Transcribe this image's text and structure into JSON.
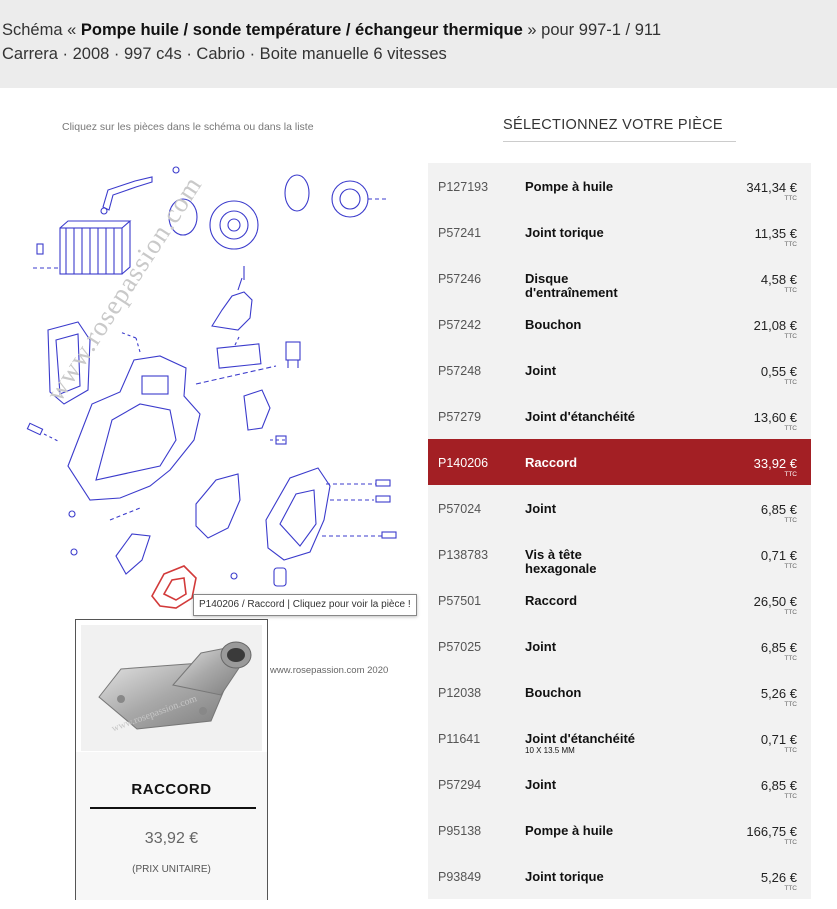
{
  "header": {
    "line1_prefix": "Schéma « ",
    "line1_bold": "Pompe huile / sonde température / échangeur thermique",
    "line1_suffix": " » pour 997-1 / 911",
    "line2": "Carrera · 2008 · 997 c4s · Cabrio · Boite manuelle 6 vitesses"
  },
  "diagram": {
    "hint": "Cliquez sur les pièces dans le schéma ou dans la liste",
    "watermark": "www.rosepassion.com",
    "copyright": "www.rosepassion.com 2020"
  },
  "parts_panel": {
    "title": "SÉLECTIONNEZ VOTRE PIÈCE",
    "ttc_label": "TTC",
    "items": [
      {
        "ref": "P127193",
        "name": "Pompe à huile",
        "sub": "",
        "price": "341,34 €"
      },
      {
        "ref": "P57241",
        "name": "Joint torique",
        "sub": "",
        "price": "11,35 €"
      },
      {
        "ref": "P57246",
        "name": "Disque d'entraînement",
        "sub": "",
        "price": "4,58 €"
      },
      {
        "ref": "P57242",
        "name": "Bouchon",
        "sub": "",
        "price": "21,08 €"
      },
      {
        "ref": "P57248",
        "name": "Joint",
        "sub": "",
        "price": "0,55 €"
      },
      {
        "ref": "P57279",
        "name": "Joint d'étanchéité",
        "sub": "",
        "price": "13,60 €"
      },
      {
        "ref": "P140206",
        "name": "Raccord",
        "sub": "",
        "price": "33,92 €"
      },
      {
        "ref": "P57024",
        "name": "Joint",
        "sub": "",
        "price": "6,85 €"
      },
      {
        "ref": "P138783",
        "name": "Vis à tête hexagonale",
        "sub": "",
        "price": "0,71 €"
      },
      {
        "ref": "P57501",
        "name": "Raccord",
        "sub": "",
        "price": "26,50 €"
      },
      {
        "ref": "P57025",
        "name": "Joint",
        "sub": "",
        "price": "6,85 €"
      },
      {
        "ref": "P12038",
        "name": "Bouchon",
        "sub": "",
        "price": "5,26 €"
      },
      {
        "ref": "P11641",
        "name": "Joint d'étanchéité",
        "sub": "10 X 13.5 MM",
        "price": "0,71 €"
      },
      {
        "ref": "P57294",
        "name": "Joint",
        "sub": "",
        "price": "6,85 €"
      },
      {
        "ref": "P95138",
        "name": "Pompe à huile",
        "sub": "",
        "price": "166,75 €"
      },
      {
        "ref": "P93849",
        "name": "Joint torique",
        "sub": "",
        "price": "5,26 €"
      }
    ],
    "active_index": 6
  },
  "tooltip": {
    "text": "P140206 / Raccord  | Cliquez pour voir la pièce !"
  },
  "popup": {
    "watermark": "www.rosepassion.com",
    "title": "RACCORD",
    "price": "33,92 €",
    "unit": "(PRIX UNITAIRE)"
  },
  "colors": {
    "accent": "#a31f24",
    "diagram_stroke": "#3b3bcc",
    "header_bg": "#ececec",
    "row_bg": "#f2f2f2"
  }
}
